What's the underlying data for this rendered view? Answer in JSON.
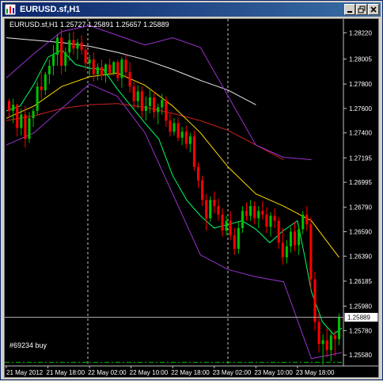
{
  "window": {
    "title": "EURUSD.sf,H1"
  },
  "chart_info": {
    "header": "EURUSD.sf,H1  1.25727 1.25891 1.25657 1.25889",
    "order_label": "#69234 buy",
    "current_price": "1.25889"
  },
  "colors": {
    "background": "#000000",
    "bull_candle": "#00c000",
    "bear_candle": "#ff0000",
    "bollinger": "#9933cc",
    "ma_fast": "#00ff66",
    "ma_mid": "#ffd700",
    "ma_slow": "#cc2222",
    "ma_long": "#e8e8e8"
  },
  "chart_data": {
    "type": "candlestick",
    "symbol": "EURUSD.sf",
    "timeframe": "H1",
    "y_ticks": [
      "1.28220",
      "1.28005",
      "1.27800",
      "1.27600",
      "1.27400",
      "1.27195",
      "1.26995",
      "1.26790",
      "1.26590",
      "1.26390",
      "1.26185",
      "1.25980",
      "1.25780",
      "1.25580"
    ],
    "x_ticks": [
      "21 May 2012",
      "21 May 18:00",
      "22 May 02:00",
      "22 May 10:00",
      "22 May 18:00",
      "23 May 02:00",
      "23 May 10:00",
      "23 May 18:00"
    ],
    "ylim": [
      1.2549,
      1.2832
    ],
    "last_price": 1.25889,
    "order_level": 1.2552,
    "candles": [
      [
        1.2766,
        1.2768,
        1.2752,
        1.2758
      ],
      [
        1.2758,
        1.2768,
        1.2748,
        1.2763
      ],
      [
        1.2763,
        1.2764,
        1.2737,
        1.2744
      ],
      [
        1.2744,
        1.276,
        1.2738,
        1.2755
      ],
      [
        1.2755,
        1.2762,
        1.2728,
        1.2735
      ],
      [
        1.2735,
        1.2757,
        1.2732,
        1.2752
      ],
      [
        1.2752,
        1.276,
        1.2745,
        1.2758
      ],
      [
        1.2758,
        1.2782,
        1.2755,
        1.2778
      ],
      [
        1.2778,
        1.279,
        1.2768,
        1.2775
      ],
      [
        1.2775,
        1.279,
        1.2771,
        1.2788
      ],
      [
        1.2788,
        1.28,
        1.278,
        1.2795
      ],
      [
        1.2795,
        1.2812,
        1.2787,
        1.2804
      ],
      [
        1.2804,
        1.2821,
        1.2795,
        1.2818
      ],
      [
        1.2818,
        1.2825,
        1.2788,
        1.2795
      ],
      [
        1.2795,
        1.281,
        1.279,
        1.2806
      ],
      [
        1.2806,
        1.2822,
        1.2799,
        1.2816
      ],
      [
        1.2816,
        1.2823,
        1.2804,
        1.2809
      ],
      [
        1.2809,
        1.2817,
        1.28,
        1.2814
      ],
      [
        1.2814,
        1.282,
        1.2804,
        1.2808
      ],
      [
        1.2808,
        1.2812,
        1.2792,
        1.2797
      ],
      [
        1.2797,
        1.2804,
        1.2786,
        1.28
      ],
      [
        1.28,
        1.2806,
        1.2782,
        1.2788
      ],
      [
        1.2788,
        1.2797,
        1.2783,
        1.2794
      ],
      [
        1.2794,
        1.28,
        1.2783,
        1.2787
      ],
      [
        1.2787,
        1.2797,
        1.2781,
        1.2796
      ],
      [
        1.2796,
        1.2801,
        1.2786,
        1.2789
      ],
      [
        1.2789,
        1.2799,
        1.2787,
        1.2798
      ],
      [
        1.2798,
        1.28,
        1.2782,
        1.2785
      ],
      [
        1.2785,
        1.2802,
        1.2777,
        1.28
      ],
      [
        1.28,
        1.2804,
        1.2785,
        1.279
      ],
      [
        1.279,
        1.2798,
        1.2773,
        1.2778
      ],
      [
        1.2778,
        1.2782,
        1.276,
        1.2766
      ],
      [
        1.2766,
        1.2779,
        1.276,
        1.2774
      ],
      [
        1.2774,
        1.2778,
        1.2752,
        1.2758
      ],
      [
        1.2758,
        1.277,
        1.275,
        1.2762
      ],
      [
        1.2762,
        1.2775,
        1.2756,
        1.2769
      ],
      [
        1.2769,
        1.2774,
        1.2752,
        1.2757
      ],
      [
        1.2757,
        1.2764,
        1.2747,
        1.2761
      ],
      [
        1.2761,
        1.2772,
        1.2755,
        1.2767
      ],
      [
        1.2767,
        1.277,
        1.2745,
        1.275
      ],
      [
        1.275,
        1.2756,
        1.2737,
        1.2741
      ],
      [
        1.2741,
        1.2752,
        1.2738,
        1.2748
      ],
      [
        1.2748,
        1.2752,
        1.2733,
        1.2736
      ],
      [
        1.2736,
        1.2745,
        1.273,
        1.2741
      ],
      [
        1.2741,
        1.2746,
        1.2727,
        1.2731
      ],
      [
        1.2731,
        1.274,
        1.2724,
        1.2737
      ],
      [
        1.2737,
        1.2742,
        1.2709,
        1.2712
      ],
      [
        1.2712,
        1.2716,
        1.2695,
        1.2701
      ],
      [
        1.2701,
        1.2705,
        1.268,
        1.2685
      ],
      [
        1.2685,
        1.269,
        1.266,
        1.267
      ],
      [
        1.267,
        1.2688,
        1.2667,
        1.2685
      ],
      [
        1.2685,
        1.2692,
        1.2674,
        1.268
      ],
      [
        1.268,
        1.2686,
        1.2668,
        1.2673
      ],
      [
        1.2673,
        1.2678,
        1.2655,
        1.266
      ],
      [
        1.266,
        1.2672,
        1.2656,
        1.2668
      ],
      [
        1.2668,
        1.2676,
        1.2652,
        1.2656
      ],
      [
        1.2656,
        1.2662,
        1.264,
        1.2645
      ],
      [
        1.2645,
        1.2667,
        1.2641,
        1.2662
      ],
      [
        1.2662,
        1.268,
        1.2658,
        1.2676
      ],
      [
        1.2676,
        1.2683,
        1.2668,
        1.2672
      ],
      [
        1.2672,
        1.2685,
        1.2668,
        1.268
      ],
      [
        1.268,
        1.2684,
        1.2665,
        1.267
      ],
      [
        1.267,
        1.268,
        1.2662,
        1.2676
      ],
      [
        1.2676,
        1.2684,
        1.2669,
        1.2673
      ],
      [
        1.2673,
        1.2679,
        1.2658,
        1.2663
      ],
      [
        1.2663,
        1.2675,
        1.2655,
        1.2672
      ],
      [
        1.2672,
        1.2678,
        1.2662,
        1.2668
      ],
      [
        1.2668,
        1.2671,
        1.2645,
        1.265
      ],
      [
        1.265,
        1.2662,
        1.2632,
        1.2638
      ],
      [
        1.2638,
        1.2652,
        1.2633,
        1.2647
      ],
      [
        1.2647,
        1.2663,
        1.2642,
        1.2659
      ],
      [
        1.2659,
        1.2667,
        1.2643,
        1.2648
      ],
      [
        1.2648,
        1.2664,
        1.264,
        1.2661
      ],
      [
        1.2661,
        1.2676,
        1.2657,
        1.2673
      ],
      [
        1.2673,
        1.268,
        1.266,
        1.2665
      ],
      [
        1.2665,
        1.2671,
        1.2612,
        1.262
      ],
      [
        1.262,
        1.2626,
        1.2578,
        1.2585
      ],
      [
        1.2585,
        1.2591,
        1.256,
        1.2567
      ],
      [
        1.2567,
        1.2575,
        1.255,
        1.257
      ],
      [
        1.257,
        1.258,
        1.2556,
        1.2562
      ],
      [
        1.2562,
        1.2578,
        1.2553,
        1.2574
      ],
      [
        1.2574,
        1.2578,
        1.2557,
        1.2571
      ],
      [
        1.2571,
        1.2592,
        1.2566,
        1.2589
      ]
    ],
    "indicators": {
      "ma_long": [
        [
          0,
          1.2818
        ],
        [
          20,
          1.2816
        ],
        [
          40,
          1.2814
        ],
        [
          60,
          1.2811
        ],
        [
          80,
          1.2806
        ],
        [
          100,
          1.28
        ],
        [
          120,
          1.2792
        ],
        [
          140,
          1.2783
        ],
        [
          160,
          1.2775
        ],
        [
          180,
          1.2763
        ]
      ],
      "ma_slow": [
        [
          0,
          1.275
        ],
        [
          20,
          1.2754
        ],
        [
          40,
          1.276
        ],
        [
          60,
          1.2763
        ],
        [
          80,
          1.2764
        ],
        [
          100,
          1.2761
        ],
        [
          120,
          1.2756
        ],
        [
          140,
          1.275
        ],
        [
          160,
          1.2742
        ],
        [
          180,
          1.273
        ],
        [
          200,
          1.2718
        ]
      ],
      "ma_mid": [
        [
          0,
          1.2752
        ],
        [
          20,
          1.2762
        ],
        [
          40,
          1.2778
        ],
        [
          60,
          1.2786
        ],
        [
          80,
          1.2789
        ],
        [
          100,
          1.2779
        ],
        [
          120,
          1.2762
        ],
        [
          140,
          1.274
        ],
        [
          160,
          1.2712
        ],
        [
          180,
          1.269
        ],
        [
          200,
          1.268
        ],
        [
          220,
          1.2668
        ],
        [
          240,
          1.2638
        ]
      ],
      "ma_fast": [
        [
          0,
          1.2758
        ],
        [
          10,
          1.2762
        ],
        [
          20,
          1.278
        ],
        [
          30,
          1.2802
        ],
        [
          40,
          1.2808
        ],
        [
          50,
          1.2796
        ],
        [
          60,
          1.2793
        ],
        [
          70,
          1.2792
        ],
        [
          80,
          1.2776
        ],
        [
          90,
          1.2762
        ],
        [
          100,
          1.2748
        ],
        [
          110,
          1.2735
        ],
        [
          120,
          1.2705
        ],
        [
          130,
          1.2685
        ],
        [
          140,
          1.2672
        ],
        [
          150,
          1.2662
        ],
        [
          160,
          1.2665
        ],
        [
          170,
          1.2668
        ],
        [
          180,
          1.2661
        ],
        [
          190,
          1.265
        ],
        [
          200,
          1.266
        ],
        [
          210,
          1.2668
        ],
        [
          215,
          1.264
        ],
        [
          220,
          1.261
        ],
        [
          228,
          1.2585
        ],
        [
          236,
          1.2575
        ],
        [
          242,
          1.258
        ]
      ],
      "bb_upper": [
        [
          0,
          1.2785
        ],
        [
          20,
          1.2805
        ],
        [
          40,
          1.2823
        ],
        [
          60,
          1.2828
        ],
        [
          80,
          1.282
        ],
        [
          100,
          1.2812
        ],
        [
          120,
          1.2818
        ],
        [
          140,
          1.281
        ],
        [
          160,
          1.277
        ],
        [
          180,
          1.273
        ],
        [
          200,
          1.272
        ],
        [
          220,
          1.2718
        ]
      ],
      "bb_lower": [
        [
          0,
          1.273
        ],
        [
          20,
          1.274
        ],
        [
          40,
          1.276
        ],
        [
          60,
          1.278
        ],
        [
          80,
          1.277
        ],
        [
          100,
          1.274
        ],
        [
          120,
          1.269
        ],
        [
          140,
          1.264
        ],
        [
          160,
          1.2628
        ],
        [
          180,
          1.2622
        ],
        [
          200,
          1.2618
        ],
        [
          220,
          1.2555
        ],
        [
          242,
          1.256
        ]
      ]
    }
  }
}
